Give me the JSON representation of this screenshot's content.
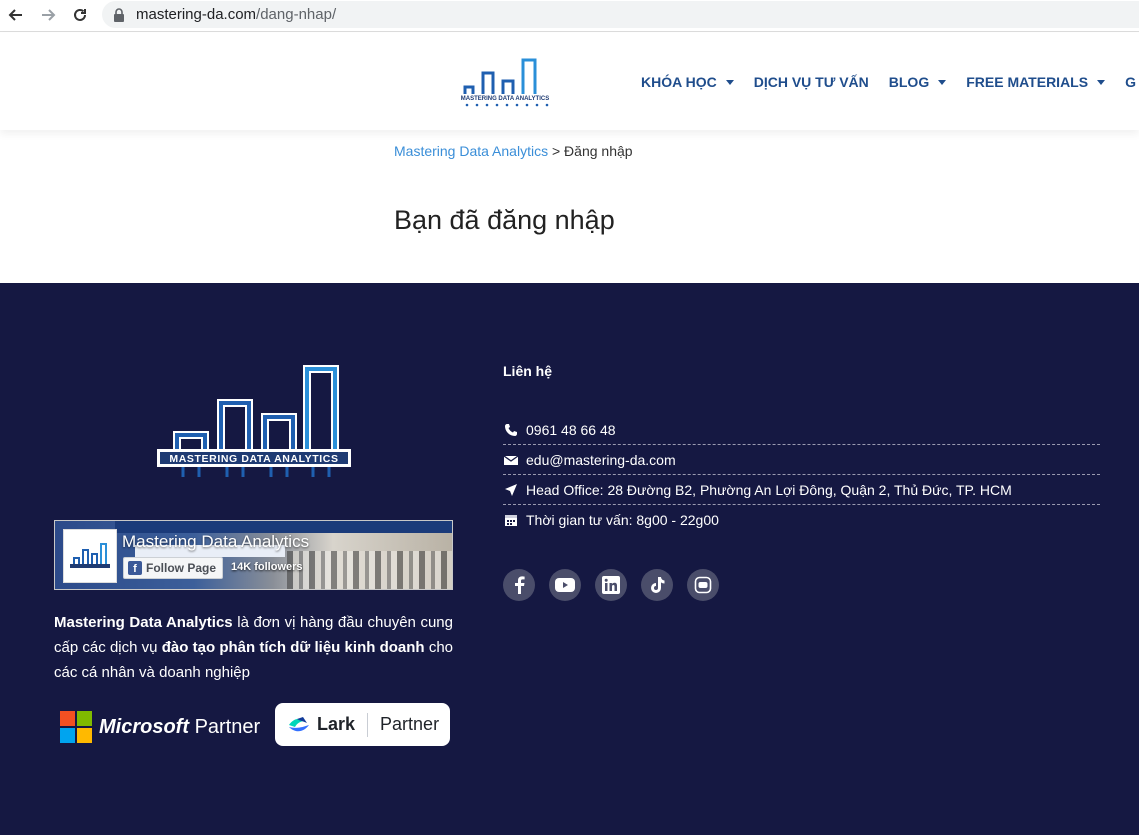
{
  "browser": {
    "url_domain": "mastering-da.com",
    "url_path": "/dang-nhap/"
  },
  "header": {
    "logo_alt": "MASTERING DATA ANALYTICS",
    "nav": [
      {
        "label": "KHÓA HỌC",
        "has_dropdown": true
      },
      {
        "label": "DỊCH VỤ TƯ VẤN",
        "has_dropdown": false
      },
      {
        "label": "BLOG",
        "has_dropdown": true
      },
      {
        "label": "FREE MATERIALS",
        "has_dropdown": true
      },
      {
        "label": "G",
        "has_dropdown": false
      }
    ]
  },
  "breadcrumb": {
    "home": "Mastering Data Analytics",
    "separator": ">",
    "current": "Đăng nhập"
  },
  "main": {
    "title": "Bạn đã đăng nhập"
  },
  "footer": {
    "logo_text": "MASTERING DATA ANALYTICS",
    "facebook": {
      "page_name": "Mastering Data Analytics",
      "follow_label": "Follow Page",
      "followers": "14K followers"
    },
    "description": {
      "part1_bold": "Mastering Data Analytics",
      "part2": " là đơn vị hàng đầu chuyên cung cấp các dịch vụ ",
      "part3_bold": "đào tạo phân tích dữ liệu kinh doanh",
      "part4": " cho các cá nhân và doanh nghiệp"
    },
    "partners": {
      "microsoft_word": "Microsoft",
      "microsoft_partner": "Partner",
      "lark_word": "Lark",
      "lark_partner": "Partner"
    },
    "contact": {
      "title": "Liên hệ",
      "phone": "0961 48 66 48",
      "email": "edu@mastering-da.com",
      "address": "Head Office: 28 Đường B2, Phường An Lợi Đông, Quận 2, Thủ Đức, TP. HCM",
      "hours": "Thời gian tư vấn: 8g00 - 22g00"
    },
    "socials": [
      "facebook-icon",
      "youtube-icon",
      "linkedin-icon",
      "tiktok-icon",
      "zalo-icon"
    ]
  },
  "colors": {
    "nav_text": "#1f4d8c",
    "footer_bg": "#151842",
    "breadcrumb_link": "#3a8ed8"
  }
}
